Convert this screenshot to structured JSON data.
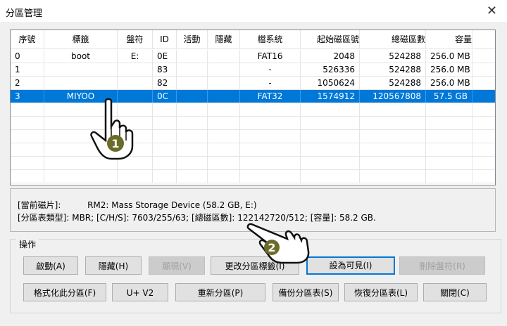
{
  "window": {
    "title": "分區管理",
    "close_glyph": "✕"
  },
  "table": {
    "headers": [
      "序號",
      "標籤",
      "盤符",
      "ID",
      "活動",
      "隱藏",
      "檔系統",
      "起始磁區號",
      "總磁區數",
      "容量"
    ],
    "rows": [
      [
        "0",
        "boot",
        "E:",
        "0E",
        "",
        "",
        "FAT16",
        "2048",
        "524288",
        "256.0 MB"
      ],
      [
        "1",
        "",
        "",
        "83",
        "",
        "",
        "-",
        "526336",
        "524288",
        "256.0 MB"
      ],
      [
        "2",
        "",
        "",
        "82",
        "",
        "",
        "-",
        "1050624",
        "524288",
        "256.0 MB"
      ],
      [
        "3",
        "MIYOO",
        "",
        "0C",
        "",
        "",
        "FAT32",
        "1574912",
        "120567808",
        "57.5 GB"
      ]
    ],
    "selected_row": 3
  },
  "disk_info": {
    "line1_label": "[當前磁片]:",
    "line1_value": "RM2: Mass Storage Device (58.2 GB, E:)",
    "line2": "[分區表類型]:   MBR;     [C/H/S]: 7603/255/63; [總磁區數]: 122142720/512; [容量]: 58.2 GB."
  },
  "actions": {
    "caption": "操作",
    "row1": [
      {
        "label": "啟動(A)",
        "enabled": true
      },
      {
        "label": "隱藏(H)",
        "enabled": true
      },
      {
        "label": "顯現(V)",
        "enabled": false
      },
      {
        "label": "更改分區標籤(I)",
        "enabled": true
      },
      {
        "label": "設為可見(I)",
        "enabled": true,
        "focused": true
      },
      {
        "label": "刪除盤符(R)",
        "enabled": false
      }
    ],
    "row2": [
      {
        "label": "格式化此分區(F)",
        "enabled": true
      },
      {
        "label": "U+ V2",
        "enabled": true
      },
      {
        "label": "重新分區(P)",
        "enabled": true
      },
      {
        "label": "備份分區表(S)",
        "enabled": true
      },
      {
        "label": "恢復分區表(L)",
        "enabled": true
      },
      {
        "label": "關閉(C)",
        "enabled": true
      }
    ]
  },
  "annotations": {
    "step1": "1",
    "step2": "2",
    "hand_color": "#ffffff",
    "badge_color": "#6b6b2a"
  }
}
